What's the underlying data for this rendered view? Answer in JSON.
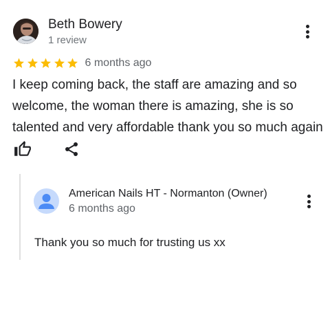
{
  "review": {
    "reviewer_name": "Beth Bowery",
    "review_count": "1 review",
    "rating": 5,
    "rating_max": 5,
    "date": "6 months ago",
    "text": "I keep coming back, the staff are amazing and so welcome, the woman there is amazing, she is so talented and very affordable thank you so much again",
    "star_color": "#fbbc04"
  },
  "reply": {
    "owner_name": "American Nails HT - Normanton (Owner)",
    "date": "6 months ago",
    "text": "Thank you so much for trusting us xx",
    "avatar_bg": "#c6dafc",
    "avatar_fg": "#4c8bf5"
  },
  "icons": {
    "more": "more-vert-icon",
    "like": "thumb-up-outline-icon",
    "share": "share-icon"
  }
}
